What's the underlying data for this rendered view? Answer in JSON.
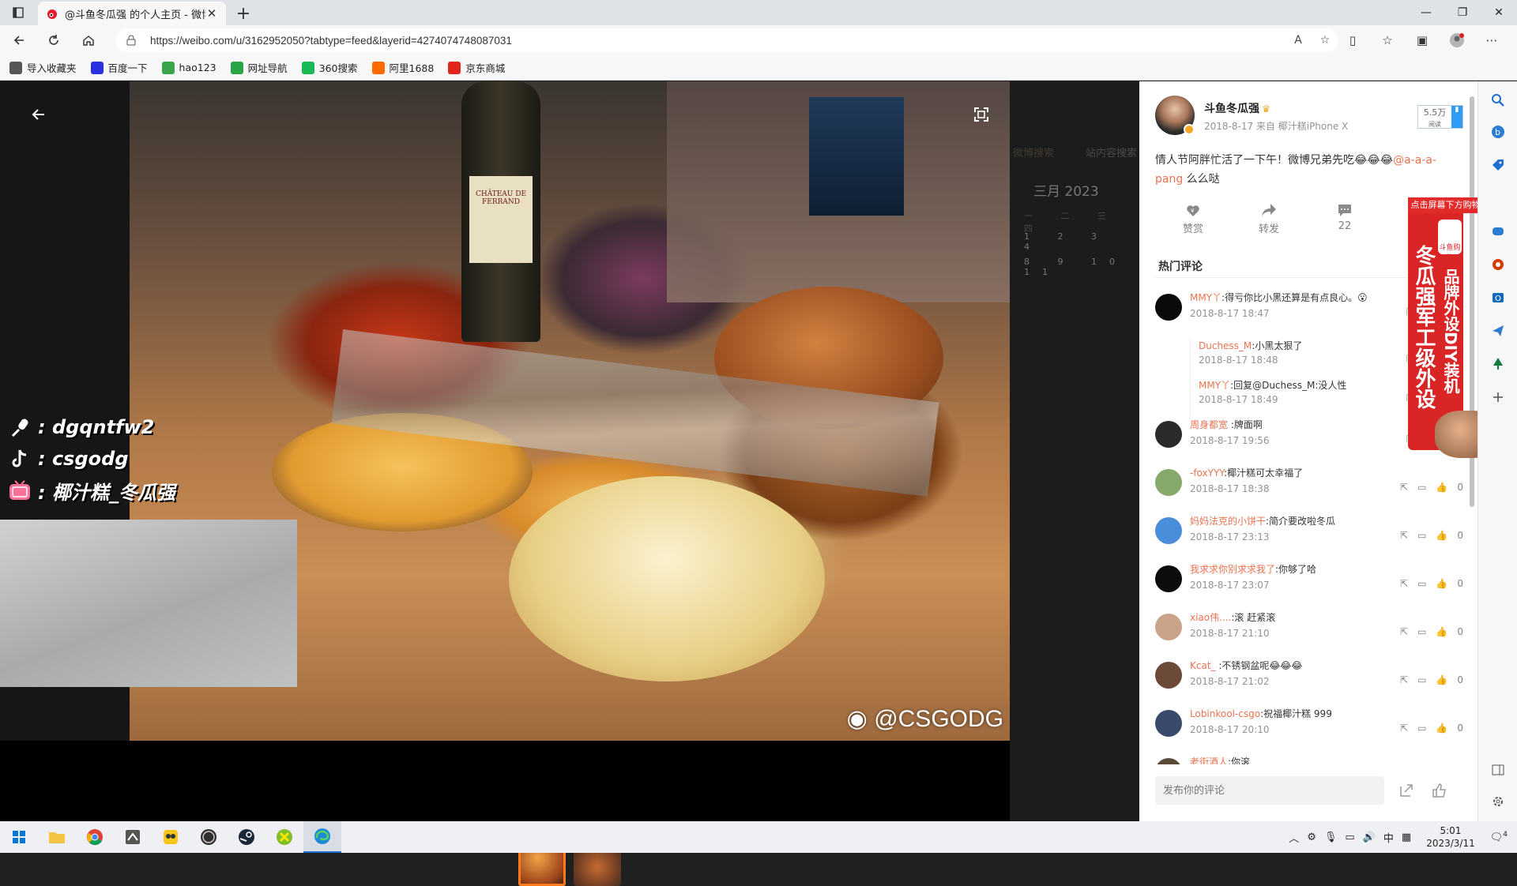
{
  "browser": {
    "tab_title": "@斗鱼冬瓜强 的个人主页 - 微博",
    "url": "https://weibo.com/u/3162952050?tabtype=feed&layerid=4274074748087031"
  },
  "bookmarks": [
    {
      "label": "导入收藏夹",
      "color": "#555555"
    },
    {
      "label": "百度一下",
      "color": "#2932e1"
    },
    {
      "label": "hao123",
      "color": "#3aa54a"
    },
    {
      "label": "网址导航",
      "color": "#2aa546"
    },
    {
      "label": "360搜索",
      "color": "#19b955"
    },
    {
      "label": "阿里1688",
      "color": "#ff6a00"
    },
    {
      "label": "京东商城",
      "color": "#e1251b"
    }
  ],
  "overlay": {
    "rows": [
      {
        "icon": "mic-icon",
        "text": ": dgqntfw2"
      },
      {
        "icon": "tiktok-icon",
        "text": ": csgodg"
      },
      {
        "icon": "bilibili-icon",
        "text": ": 椰汁糕_冬瓜强"
      }
    ]
  },
  "photo": {
    "watermark": "@CSGODG",
    "bottle_label": "CHÂTEAU DE FERRAND"
  },
  "ghost": {
    "month": "三月 2023",
    "tab1": "微博搜索",
    "tab2": "站内容搜索",
    "week": "一 二 三 四",
    "row1": "1 2 3 4",
    "row2": "8 9 10 11"
  },
  "post": {
    "author": "斗鱼冬瓜强",
    "meta": "2018-8-17  来自 椰汁糕iPhone X",
    "fans_count": "5.5万",
    "fans_label": "阅读",
    "text_main": "情人节阿胖忙活了一下午！微博兄弟先吃😂😂😂",
    "text_link": "@a-a-a-pang",
    "text_tail": " 么么哒",
    "actions": {
      "like": "赞赏",
      "repost": "转发",
      "comments": "22"
    },
    "hot_title": "热门评论",
    "input_placeholder": "发布你的评论"
  },
  "comments": [
    {
      "type": "c",
      "nick": "MMY丫",
      "text": ":得亏你比小黑还算是有点良心。😮",
      "time": "2018-8-17 18:47",
      "likes": "",
      "avatar": "#0a0a0a"
    },
    {
      "type": "r",
      "nick": "Duchess_M",
      "text": ":小黑太狠了",
      "time": "2018-8-17 18:48"
    },
    {
      "type": "r",
      "nick": "MMY丫",
      "text": ":回复@Duchess_M:没人性",
      "time": "2018-8-17 18:49"
    },
    {
      "type": "c",
      "nick": "周身都宽",
      "text": " :牌面啊",
      "time": "2018-8-17 19:56",
      "likes": "",
      "avatar": "#2b2b2b"
    },
    {
      "type": "c",
      "nick": "-foxYYY",
      "text": ":椰汁糕可太幸福了",
      "time": "2018-8-17 18:38",
      "likes": "0",
      "avatar": "#86a86a"
    },
    {
      "type": "c",
      "nick": "妈妈法克的小饼干",
      "text": ":简介要改啦冬瓜",
      "time": "2018-8-17 23:13",
      "likes": "0",
      "avatar": "#4a8ed9"
    },
    {
      "type": "c",
      "nick": "我求求你别求求我了",
      "text": ":你够了哈",
      "time": "2018-8-17 23:07",
      "likes": "0",
      "avatar": "#0c0c0c"
    },
    {
      "type": "c",
      "nick": "xiao伟....",
      "text": ":滚  赶紧滚",
      "time": "2018-8-17 21:10",
      "likes": "0",
      "avatar": "#c9a48a"
    },
    {
      "type": "c",
      "nick": "Kcat_",
      "text": " :不锈钢盆呢😂😂😂",
      "time": "2018-8-17 21:02",
      "likes": "0",
      "avatar": "#6b4a3a"
    },
    {
      "type": "c",
      "nick": "Lobinkool-csgo",
      "text": ":祝福椰汁糕 999",
      "time": "2018-8-17 20:10",
      "likes": "0",
      "avatar": "#3a4a6a"
    },
    {
      "type": "c",
      "nick": "老街酒人",
      "text": ":你滚",
      "time": "",
      "likes": "",
      "avatar": "#5a4a3a"
    }
  ],
  "ad": {
    "top": "点击屏幕下方购物车下单",
    "badge": "斗鱼购物",
    "big": "冬瓜强军工级外设",
    "small": "品牌外设DIY装机"
  },
  "taskbar": {
    "time": "5:01",
    "date": "2023/3/11",
    "ime": "中",
    "notif": "4"
  }
}
